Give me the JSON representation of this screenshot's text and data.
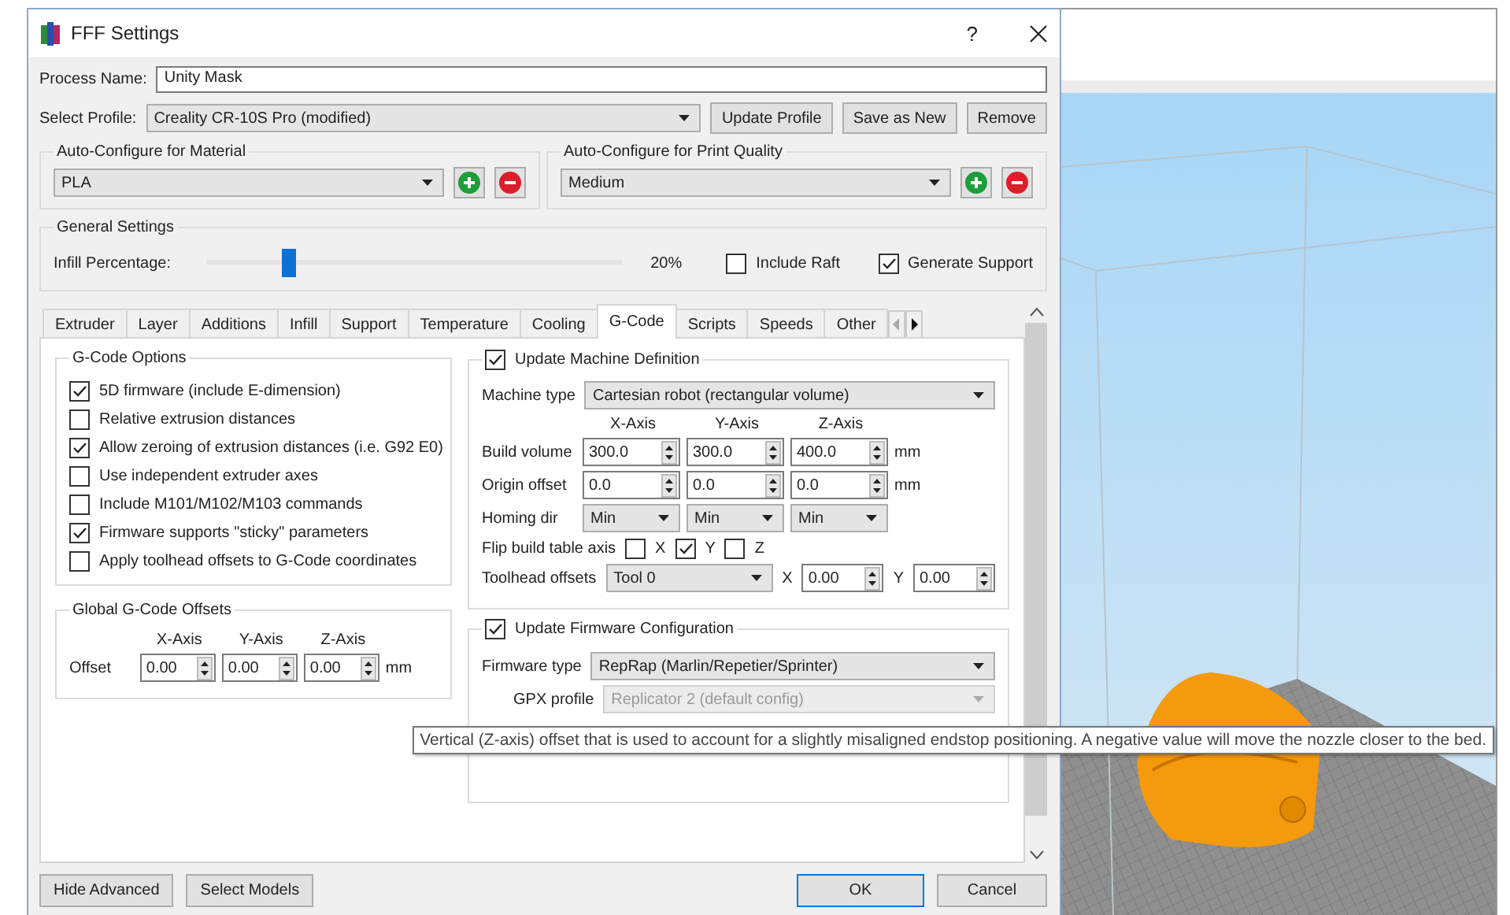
{
  "window": {
    "title": "FFF Settings",
    "help": "?"
  },
  "process_name": {
    "label": "Process Name:",
    "value": "Unity Mask"
  },
  "profile": {
    "label": "Select Profile:",
    "value": "Creality CR-10S Pro (modified)",
    "buttons": [
      "Update Profile",
      "Save as New",
      "Remove"
    ]
  },
  "material": {
    "title": "Auto-Configure for Material",
    "value": "PLA"
  },
  "quality": {
    "title": "Auto-Configure for Print Quality",
    "value": "Medium"
  },
  "general": {
    "title": "General Settings",
    "infill_label": "Infill Percentage:",
    "infill": {
      "level": 0.2,
      "reading": "20%"
    },
    "options": [
      {
        "label": "Include Raft",
        "checked": false
      },
      {
        "label": "Generate Support",
        "checked": true
      }
    ]
  },
  "tabs": [
    {
      "label": "Extruder",
      "selected": false
    },
    {
      "label": "Layer",
      "selected": false
    },
    {
      "label": "Additions",
      "selected": false
    },
    {
      "label": "Infill",
      "selected": false
    },
    {
      "label": "Support",
      "selected": false
    },
    {
      "label": "Temperature",
      "selected": false
    },
    {
      "label": "Cooling",
      "selected": false
    },
    {
      "label": "G-Code",
      "selected": true
    },
    {
      "label": "Scripts",
      "selected": false
    },
    {
      "label": "Speeds",
      "selected": false
    },
    {
      "label": "Other",
      "selected": false
    }
  ],
  "gcode_options": {
    "title": "G-Code Options",
    "items": [
      {
        "label": "5D firmware (include E-dimension)",
        "checked": true
      },
      {
        "label": "Relative extrusion distances",
        "checked": false
      },
      {
        "label": "Allow zeroing of extrusion distances (i.e. G92 E0)",
        "checked": true
      },
      {
        "label": "Use independent extruder axes",
        "checked": false
      },
      {
        "label": "Include M101/M102/M103 commands",
        "checked": false
      },
      {
        "label": "Firmware supports \"sticky\" parameters",
        "checked": true
      },
      {
        "label": "Apply toolhead offsets to G-Code coordinates",
        "checked": false
      }
    ]
  },
  "offsets": {
    "title": "Global G-Code Offsets",
    "axes": [
      "X-Axis",
      "Y-Axis",
      "Z-Axis"
    ],
    "label": "Offset",
    "values": [
      "0.00",
      "0.00",
      "0.00"
    ],
    "unit": "mm"
  },
  "machine": {
    "label": "Update Machine Definition",
    "checked": true,
    "type_label": "Machine type",
    "type_value": "Cartesian robot (rectangular volume)",
    "axes": [
      "X-Axis",
      "Y-Axis",
      "Z-Axis"
    ],
    "rows": [
      {
        "label": "Build volume",
        "kind": "spin",
        "values": [
          "300.0",
          "300.0",
          "400.0"
        ],
        "unit": "mm"
      },
      {
        "label": "Origin offset",
        "kind": "spin",
        "values": [
          "0.0",
          "0.0",
          "0.0"
        ],
        "unit": "mm"
      },
      {
        "label": "Homing dir",
        "kind": "combo",
        "values": [
          "Min",
          "Min",
          "Min"
        ]
      }
    ],
    "flip": {
      "label": "Flip build table axis",
      "axes": [
        {
          "label": "X",
          "checked": false
        },
        {
          "label": "Y",
          "checked": true
        },
        {
          "label": "Z",
          "checked": false
        }
      ]
    },
    "toolhead": {
      "label": "Toolhead offsets",
      "tool": "Tool 0",
      "offsets": [
        {
          "label": "X",
          "value": "0.00"
        },
        {
          "label": "Y",
          "value": "0.00"
        }
      ]
    }
  },
  "firmware": {
    "label": "Update Firmware Configuration",
    "checked": true,
    "type_label": "Firmware type",
    "type_value": "RepRap (Marlin/Repetier/Sprinter)",
    "gpx_label": "GPX profile",
    "gpx_value": "Replicator 2 (default config)",
    "gpx_disabled": true
  },
  "tooltip": "Vertical (Z-axis) offset that is used to account for a slightly misaligned endstop positioning.  A negative value will move the nozzle closer to the bed.",
  "footer": {
    "left": [
      "Hide Advanced",
      "Select Models"
    ],
    "right": [
      "OK",
      "Cancel"
    ]
  }
}
